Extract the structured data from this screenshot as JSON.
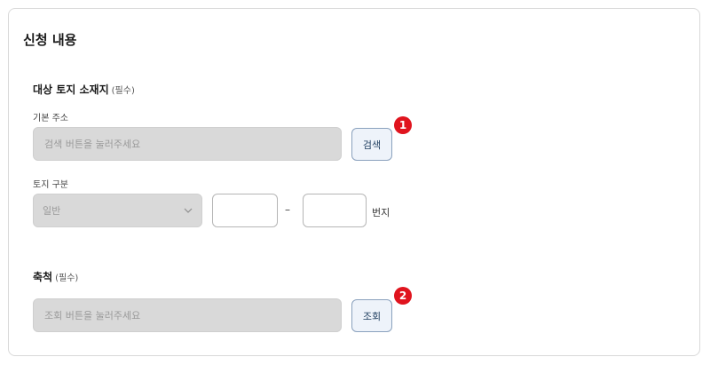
{
  "form": {
    "title": "신청 내용",
    "land_section": {
      "label": "대상 토지 소재지",
      "required": "(필수)",
      "address_label": "기본 주소",
      "address_placeholder": "검색 버튼을 눌러주세요",
      "search_button": "검색",
      "land_type_label": "토지 구분",
      "land_type_value": "일반",
      "separator": "–",
      "suffix": "번지"
    },
    "scale_section": {
      "label": "축척",
      "required": "(필수)",
      "placeholder": "조회 버튼을 눌러주세요",
      "lookup_button": "조회"
    },
    "badges": [
      "1",
      "2"
    ]
  }
}
